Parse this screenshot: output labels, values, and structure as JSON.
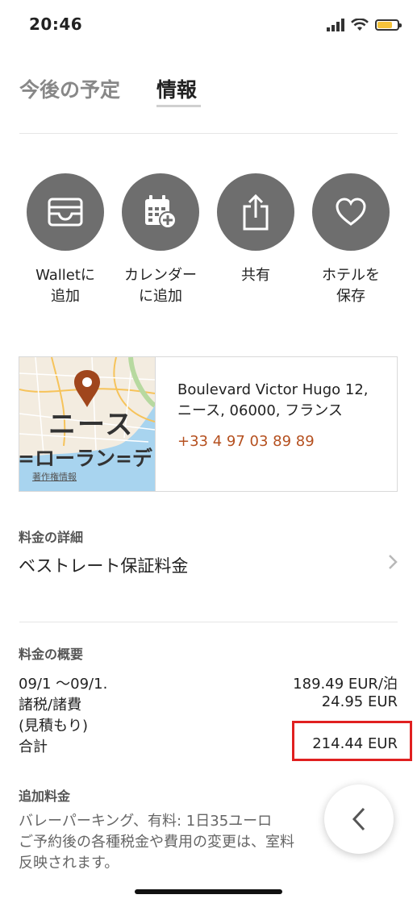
{
  "status": {
    "time": "20:46"
  },
  "tabs": [
    {
      "label": "今後の予定"
    },
    {
      "label": "情報"
    }
  ],
  "actions": [
    {
      "label": "Walletに\n追加",
      "icon": "wallet-icon"
    },
    {
      "label": "カレンダー\nに追加",
      "icon": "calendar-add-icon"
    },
    {
      "label": "共有",
      "icon": "share-icon"
    },
    {
      "label": "ホテルを\n保存",
      "icon": "heart-icon"
    }
  ],
  "location": {
    "map_label_city": "ニース",
    "map_label_street": "=ローラン=デ",
    "map_copyright": "著作権情報",
    "address": "Boulevard Victor Hugo 12,\nニース, 06000, フランス",
    "phone": "+33 4 97 03 89 89"
  },
  "rate_details": {
    "label": "料金の詳細",
    "title": "ベストレート保証料金"
  },
  "price_summary": {
    "label": "料金の概要",
    "rows": [
      {
        "left": "09/1 〜09/1.",
        "right": "189.49 EUR/泊"
      },
      {
        "left": "諸税/諸費",
        "right": "24.95 EUR"
      },
      {
        "left": "(見積もり)",
        "right": ""
      },
      {
        "left": "合計",
        "right": "214.44 EUR"
      }
    ]
  },
  "extra_charges": {
    "label": "追加料金",
    "lines": [
      "バレーパーキング、有料: 1日35ユーロ",
      "ご予約後の各種税金や費用の変更は、室料",
      "反映されます。"
    ]
  },
  "colors": {
    "action_circle": "#6e6e6e",
    "phone": "#b5501f",
    "highlight_box": "#e02020",
    "map_pin": "#a0461c"
  }
}
